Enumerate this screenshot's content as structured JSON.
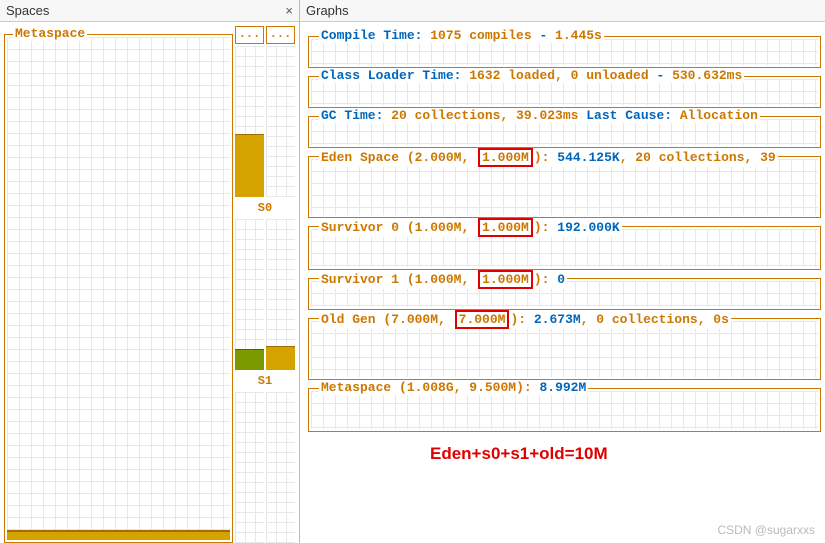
{
  "panels": {
    "spaces_title": "Spaces",
    "graphs_title": "Graphs",
    "close_glyph": "×"
  },
  "spaces": {
    "metaspace_label": "Metaspace",
    "s0_label": "S0",
    "s1_label": "S1",
    "dots": "..."
  },
  "graphs": {
    "compile": {
      "label_prefix": "Compile Time: ",
      "compiles": "1075 compiles",
      "sep": " - ",
      "time": "1.445s"
    },
    "classloader": {
      "label_prefix": "Class Loader Time: ",
      "loaded": "1632 loaded, 0 unloaded",
      "sep": " - ",
      "time": "530.632ms"
    },
    "gc": {
      "label_prefix": "GC Time: ",
      "details": "20 collections, 39.023ms",
      "cause_prefix": " Last Cause: ",
      "cause": "Allocation "
    },
    "eden": {
      "name": "Eden Space",
      "p1": "2.000M",
      "p2": "1.000M",
      "used": "544.125K",
      "extra": ", 20 collections, 39"
    },
    "s0": {
      "name": "Survivor 0",
      "p1": "1.000M",
      "p2": "1.000M",
      "used": "192.000K"
    },
    "s1": {
      "name": "Survivor 1",
      "p1": "1.000M",
      "p2": "1.000M",
      "used": "0"
    },
    "old": {
      "name": "Old Gen",
      "p1": "7.000M",
      "p2": "7.000M",
      "used": "2.673M",
      "extra": ", 0 collections, 0s"
    },
    "metaspace": {
      "name": "Metaspace",
      "p1": "1.008G",
      "p2": "9.500M",
      "used": "8.992M"
    }
  },
  "annotation": "Eden+s0+s1+old=10M",
  "watermark": "CSDN @sugarxxs"
}
